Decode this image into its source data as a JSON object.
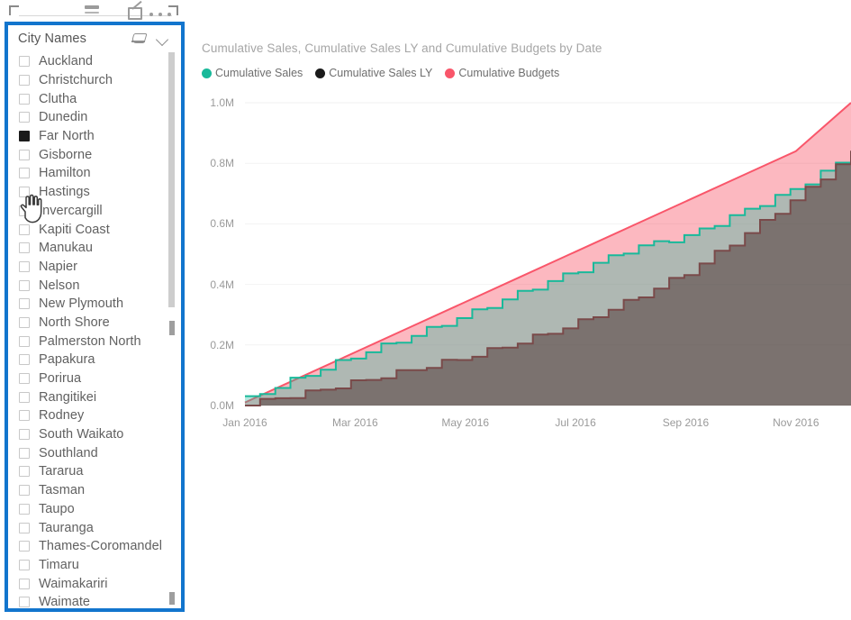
{
  "toolbar": {
    "filter_icon": "filter-icon",
    "focus_icon": "focus-mode-icon",
    "more_icon": "more-options-icon"
  },
  "slicer": {
    "title": "City Names",
    "clear_icon": "eraser-icon",
    "expand_icon": "chevron-down-icon",
    "selection_border_color": "#1275cd",
    "items": [
      {
        "label": "Auckland",
        "checked": false
      },
      {
        "label": "Christchurch",
        "checked": false
      },
      {
        "label": "Clutha",
        "checked": false
      },
      {
        "label": "Dunedin",
        "checked": false
      },
      {
        "label": "Far North",
        "checked": true
      },
      {
        "label": "Gisborne",
        "checked": false
      },
      {
        "label": "Hamilton",
        "checked": false
      },
      {
        "label": "Hastings",
        "checked": false
      },
      {
        "label": "Invercargill",
        "checked": false
      },
      {
        "label": "Kapiti Coast",
        "checked": false
      },
      {
        "label": "Manukau",
        "checked": false
      },
      {
        "label": "Napier",
        "checked": false
      },
      {
        "label": "Nelson",
        "checked": false
      },
      {
        "label": "New Plymouth",
        "checked": false
      },
      {
        "label": "North Shore",
        "checked": false
      },
      {
        "label": "Palmerston North",
        "checked": false
      },
      {
        "label": "Papakura",
        "checked": false
      },
      {
        "label": "Porirua",
        "checked": false
      },
      {
        "label": "Rangitikei",
        "checked": false
      },
      {
        "label": "Rodney",
        "checked": false
      },
      {
        "label": "South Waikato",
        "checked": false
      },
      {
        "label": "Southland",
        "checked": false
      },
      {
        "label": "Tararua",
        "checked": false
      },
      {
        "label": "Tasman",
        "checked": false
      },
      {
        "label": "Taupo",
        "checked": false
      },
      {
        "label": "Tauranga",
        "checked": false
      },
      {
        "label": "Thames-Coromandel",
        "checked": false
      },
      {
        "label": "Timaru",
        "checked": false
      },
      {
        "label": "Waimakariri",
        "checked": false
      },
      {
        "label": "Waimate",
        "checked": false
      }
    ]
  },
  "cursor": {
    "type": "hand-pointer-cursor",
    "over": "checkbox-hamilton"
  },
  "chart_data": {
    "type": "area",
    "title": "Cumulative Sales, Cumulative Sales LY and Cumulative Budgets by Date",
    "xlabel": "",
    "ylabel": "",
    "grid": true,
    "legend_position": "top-left",
    "ylim": [
      0,
      1000000
    ],
    "yticks": [
      0,
      200000,
      400000,
      600000,
      800000,
      1000000
    ],
    "ytick_labels": [
      "0.0M",
      "0.2M",
      "0.4M",
      "0.6M",
      "0.8M",
      "1.0M"
    ],
    "xtick_labels": [
      "Jan 2016",
      "Mar 2016",
      "May 2016",
      "Jul 2016",
      "Sep 2016",
      "Nov 2016"
    ],
    "colors": {
      "cumulative_sales": "#19b99a",
      "cumulative_sales_ly": "#1b1b1b",
      "cumulative_budgets": "#f9566a"
    },
    "x": [
      "Jan 2016",
      "Feb 2016",
      "Mar 2016",
      "Apr 2016",
      "May 2016",
      "Jun 2016",
      "Jul 2016",
      "Aug 2016",
      "Sep 2016",
      "Oct 2016",
      "Nov 2016",
      "Dec 2016"
    ],
    "series": [
      {
        "name": "Cumulative Sales",
        "values": [
          22000,
          96000,
          166000,
          230000,
          300000,
          375000,
          445000,
          520000,
          560000,
          640000,
          720000,
          830000
        ]
      },
      {
        "name": "Cumulative Sales LY",
        "values": [
          6000,
          38000,
          78000,
          118000,
          160000,
          212000,
          272000,
          350000,
          440000,
          560000,
          690000,
          835000
        ]
      },
      {
        "name": "Cumulative Budgets",
        "values": [
          10000,
          93000,
          176000,
          259000,
          342000,
          425000,
          508000,
          591000,
          674000,
          757000,
          840000,
          1000000
        ]
      }
    ]
  }
}
